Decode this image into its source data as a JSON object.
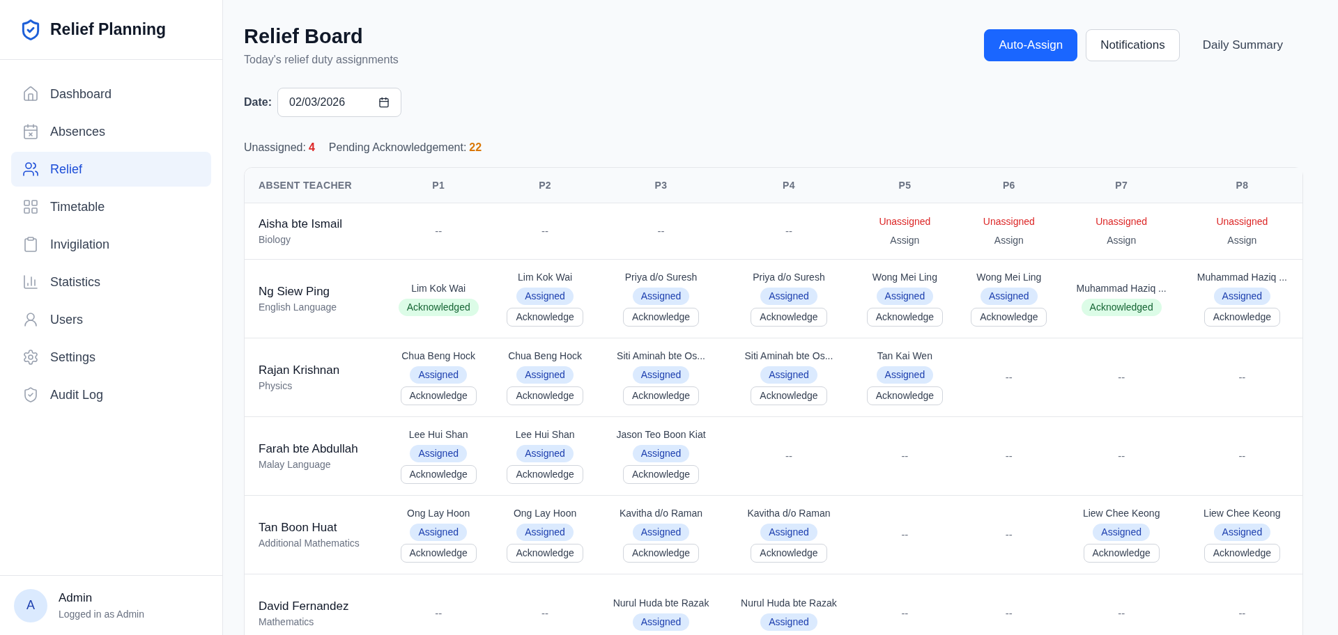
{
  "sidebar": {
    "brand": "Relief Planning",
    "items": [
      {
        "label": "Dashboard",
        "selected": false
      },
      {
        "label": "Absences",
        "selected": false
      },
      {
        "label": "Relief",
        "selected": true
      },
      {
        "label": "Timetable",
        "selected": false
      },
      {
        "label": "Invigilation",
        "selected": false
      },
      {
        "label": "Statistics",
        "selected": false
      },
      {
        "label": "Users",
        "selected": false
      },
      {
        "label": "Settings",
        "selected": false
      },
      {
        "label": "Audit Log",
        "selected": false
      }
    ],
    "user": {
      "avatar": "A",
      "name": "Admin",
      "role": "Logged in as Admin"
    }
  },
  "header": {
    "title": "Relief Board",
    "subtitle": "Today's relief duty assignments",
    "buttons": [
      {
        "label": "Auto-Assign",
        "kind": "primary"
      },
      {
        "label": "Notifications",
        "kind": "outline"
      },
      {
        "label": "Daily Summary",
        "kind": "ghost"
      }
    ]
  },
  "date": {
    "label": "Date:",
    "value": "02/03/2026"
  },
  "stats": [
    {
      "label": "Unassigned:",
      "value": "4",
      "color": "#dc2626"
    },
    {
      "label": "Pending Acknowledgement:",
      "value": "22",
      "color": "#d97706"
    }
  ],
  "table": {
    "columns": [
      "ABSENT TEACHER",
      "P1",
      "P2",
      "P3",
      "P4",
      "P5",
      "P6",
      "P7",
      "P8"
    ],
    "rows": [
      {
        "cells": [
          {
            "kind": "teacher",
            "name": "Aisha bte Ismail",
            "subject": "Biology"
          },
          {
            "kind": "none",
            "text": "--"
          },
          {
            "kind": "none",
            "text": "--"
          },
          {
            "kind": "none",
            "text": "--"
          },
          {
            "kind": "none",
            "text": "--"
          },
          {
            "kind": "unassigned",
            "text": "Unassigned",
            "action": "Assign"
          },
          {
            "kind": "unassigned",
            "text": "Unassigned",
            "action": "Assign"
          },
          {
            "kind": "unassigned",
            "text": "Unassigned",
            "action": "Assign"
          },
          {
            "kind": "unassigned",
            "text": "Unassigned",
            "action": "Assign"
          }
        ]
      },
      {
        "cells": [
          {
            "kind": "teacher",
            "name": "Ng Siew Ping",
            "subject": "English Language"
          },
          {
            "kind": "acknowledged",
            "name": "Lim Kok Wai",
            "text": "Acknowledged"
          },
          {
            "kind": "assigned",
            "name": "Lim Kok Wai",
            "text": "Assigned",
            "action": "Acknowledge"
          },
          {
            "kind": "assigned",
            "name": "Priya d/o Suresh",
            "text": "Assigned",
            "action": "Acknowledge"
          },
          {
            "kind": "assigned",
            "name": "Priya d/o Suresh",
            "text": "Assigned",
            "action": "Acknowledge"
          },
          {
            "kind": "assigned",
            "name": "Wong Mei Ling",
            "text": "Assigned",
            "action": "Acknowledge"
          },
          {
            "kind": "assigned",
            "name": "Wong Mei Ling",
            "text": "Assigned",
            "action": "Acknowledge"
          },
          {
            "kind": "acknowledged",
            "name": "Muhammad Haziq ...",
            "text": "Acknowledged"
          },
          {
            "kind": "assigned",
            "name": "Muhammad Haziq ...",
            "text": "Assigned",
            "action": "Acknowledge"
          }
        ]
      },
      {
        "cells": [
          {
            "kind": "teacher",
            "name": "Rajan Krishnan",
            "subject": "Physics"
          },
          {
            "kind": "assigned",
            "name": "Chua Beng Hock",
            "text": "Assigned",
            "action": "Acknowledge"
          },
          {
            "kind": "assigned",
            "name": "Chua Beng Hock",
            "text": "Assigned",
            "action": "Acknowledge"
          },
          {
            "kind": "assigned",
            "name": "Siti Aminah bte Os...",
            "text": "Assigned",
            "action": "Acknowledge"
          },
          {
            "kind": "assigned",
            "name": "Siti Aminah bte Os...",
            "text": "Assigned",
            "action": "Acknowledge"
          },
          {
            "kind": "assigned",
            "name": "Tan Kai Wen",
            "text": "Assigned",
            "action": "Acknowledge"
          },
          {
            "kind": "none",
            "text": "--"
          },
          {
            "kind": "none",
            "text": "--"
          },
          {
            "kind": "none",
            "text": "--"
          }
        ]
      },
      {
        "cells": [
          {
            "kind": "teacher",
            "name": "Farah bte Abdullah",
            "subject": "Malay Language"
          },
          {
            "kind": "assigned",
            "name": "Lee Hui Shan",
            "text": "Assigned",
            "action": "Acknowledge"
          },
          {
            "kind": "assigned",
            "name": "Lee Hui Shan",
            "text": "Assigned",
            "action": "Acknowledge"
          },
          {
            "kind": "assigned",
            "name": "Jason Teo Boon Kiat",
            "text": "Assigned",
            "action": "Acknowledge"
          },
          {
            "kind": "none",
            "text": "--"
          },
          {
            "kind": "none",
            "text": "--"
          },
          {
            "kind": "none",
            "text": "--"
          },
          {
            "kind": "none",
            "text": "--"
          },
          {
            "kind": "none",
            "text": "--"
          }
        ]
      },
      {
        "cells": [
          {
            "kind": "teacher",
            "name": "Tan Boon Huat",
            "subject": "Additional Mathematics"
          },
          {
            "kind": "assigned",
            "name": "Ong Lay Hoon",
            "text": "Assigned",
            "action": "Acknowledge"
          },
          {
            "kind": "assigned",
            "name": "Ong Lay Hoon",
            "text": "Assigned",
            "action": "Acknowledge"
          },
          {
            "kind": "assigned",
            "name": "Kavitha d/o Raman",
            "text": "Assigned",
            "action": "Acknowledge"
          },
          {
            "kind": "assigned",
            "name": "Kavitha d/o Raman",
            "text": "Assigned",
            "action": "Acknowledge"
          },
          {
            "kind": "none",
            "text": "--"
          },
          {
            "kind": "none",
            "text": "--"
          },
          {
            "kind": "assigned",
            "name": "Liew Chee Keong",
            "text": "Assigned",
            "action": "Acknowledge"
          },
          {
            "kind": "assigned",
            "name": "Liew Chee Keong",
            "text": "Assigned",
            "action": "Acknowledge"
          }
        ]
      },
      {
        "cells": [
          {
            "kind": "teacher",
            "name": "David Fernandez",
            "subject": "Mathematics"
          },
          {
            "kind": "none",
            "text": "--"
          },
          {
            "kind": "none",
            "text": "--"
          },
          {
            "kind": "assigned",
            "name": "Nurul Huda bte Razak",
            "text": "Assigned"
          },
          {
            "kind": "assigned",
            "name": "Nurul Huda bte Razak",
            "text": "Assigned"
          },
          {
            "kind": "none",
            "text": "--"
          },
          {
            "kind": "none",
            "text": "--"
          },
          {
            "kind": "none",
            "text": "--"
          },
          {
            "kind": "none",
            "text": "--"
          }
        ]
      }
    ]
  }
}
